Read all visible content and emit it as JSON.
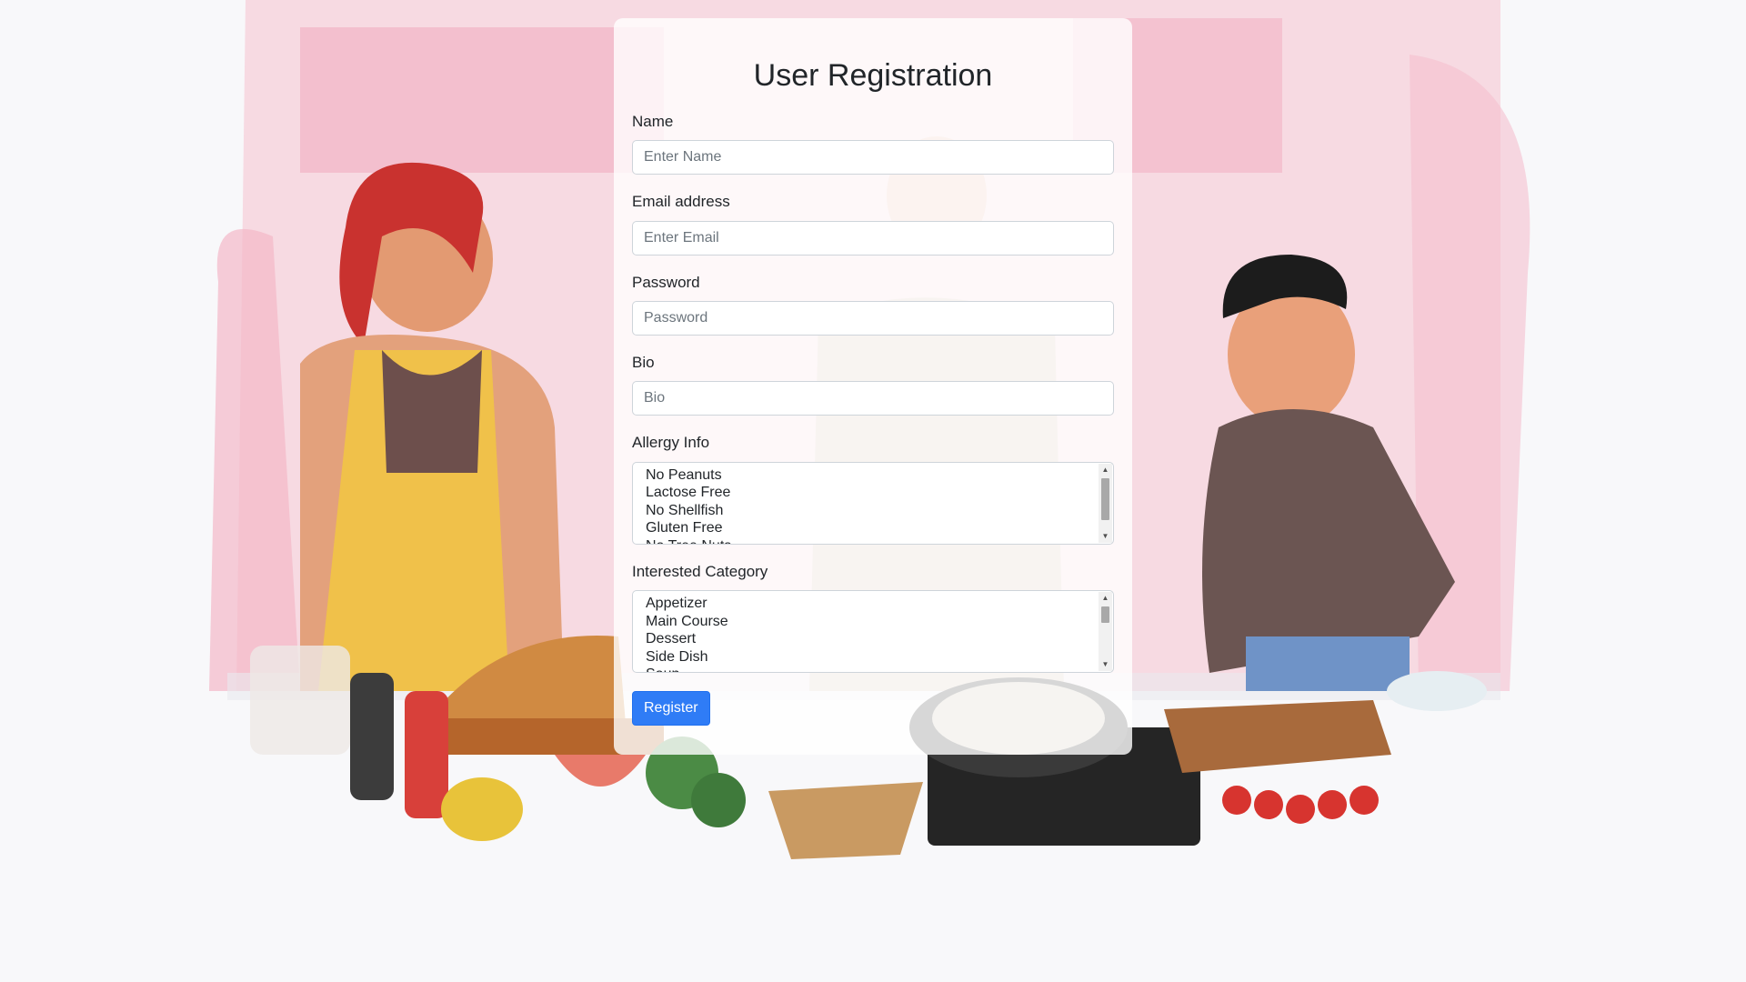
{
  "form": {
    "title": "User Registration",
    "name": {
      "label": "Name",
      "placeholder": "Enter Name",
      "value": ""
    },
    "email": {
      "label": "Email address",
      "placeholder": "Enter Email",
      "value": ""
    },
    "password": {
      "label": "Password",
      "placeholder": "Password",
      "value": ""
    },
    "bio": {
      "label": "Bio",
      "placeholder": "Bio",
      "value": ""
    },
    "allergy": {
      "label": "Allergy Info",
      "options": [
        "No Peanuts",
        "Lactose Free",
        "No Shellfish",
        "Gluten Free",
        "No Tree Nuts"
      ]
    },
    "category": {
      "label": "Interested Category",
      "options": [
        "Appetizer",
        "Main Course",
        "Dessert",
        "Side Dish",
        "Soup"
      ]
    },
    "submit_label": "Register"
  },
  "colors": {
    "button": "#2f7cf6",
    "background_accent": "#f3b8c8",
    "page_background": "#f8f8fa"
  },
  "icons": [
    "scroll-up-arrow-icon",
    "scroll-down-arrow-icon"
  ]
}
